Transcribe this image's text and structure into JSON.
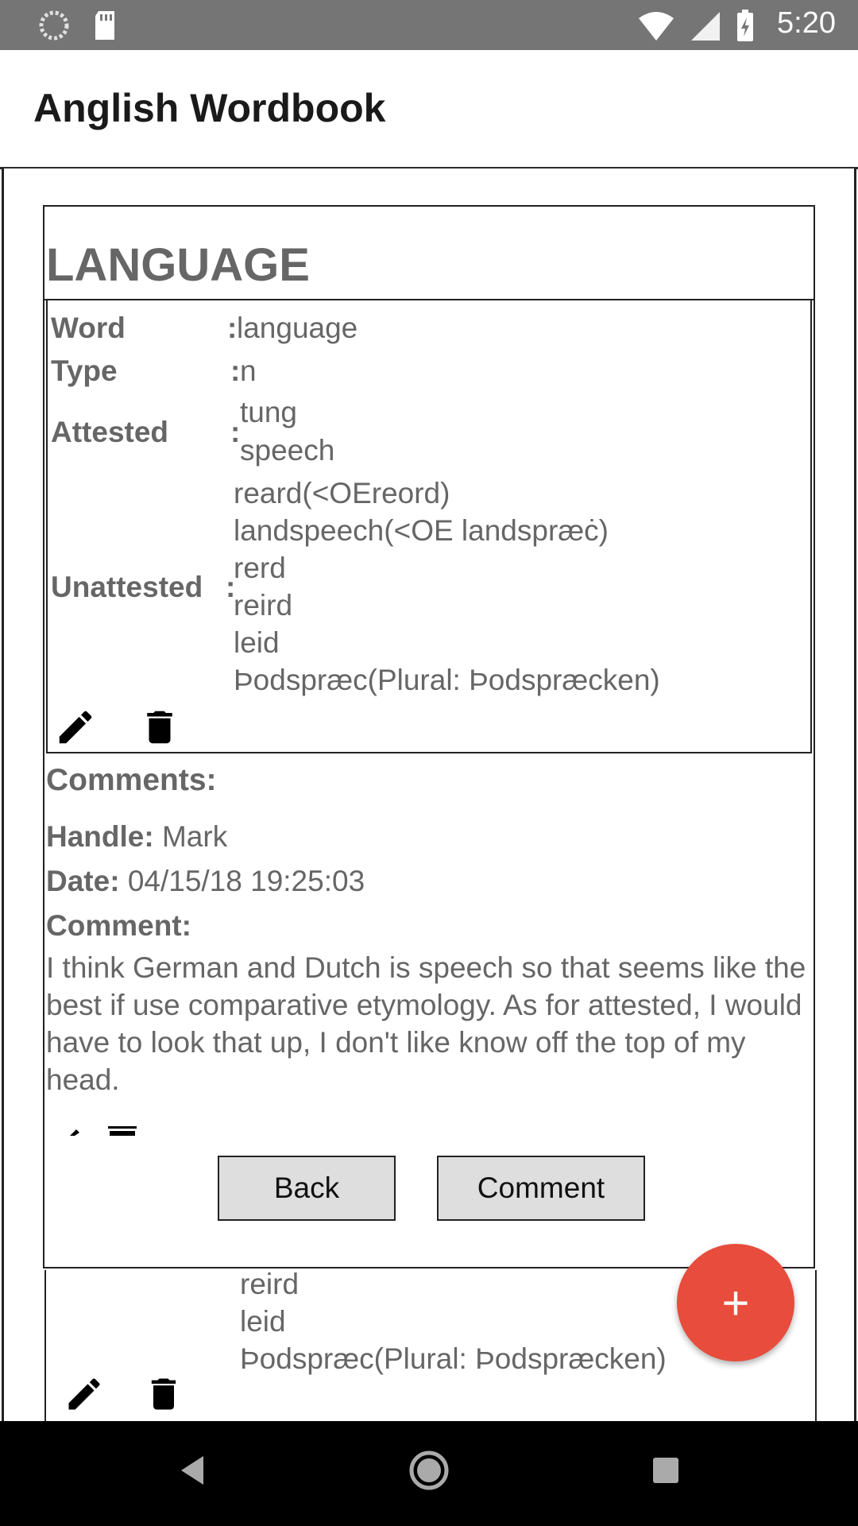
{
  "status_bar": {
    "time": "5:20"
  },
  "app_bar": {
    "title": "Anglish Wordbook"
  },
  "dialog": {
    "title": "LANGUAGE",
    "fields": {
      "word": {
        "label": "Word",
        "value": "language"
      },
      "type": {
        "label": "Type",
        "value": "n"
      },
      "attested": {
        "label": "Attested",
        "values": [
          "tung",
          "speech"
        ]
      },
      "unattested": {
        "label": "Unattested",
        "values": [
          "reard(<OEreord)",
          "landspeech(<OE landspræċ)",
          "rerd",
          "reird",
          "leid",
          "Þodspræc(Plural: Þodspræcken)"
        ]
      }
    },
    "comments": {
      "header": "Comments:",
      "handle_label": "Handle:",
      "handle_value": "Mark",
      "date_label": "Date:",
      "date_value": "04/15/18 19:25:03",
      "comment_label": "Comment:",
      "comment_text": "I think German and Dutch is speech so that seems like the best if use comparative etymology. As for attested, I would have to look that up, I don't like know off the top of my head."
    },
    "buttons": {
      "back": "Back",
      "comment": "Comment"
    }
  },
  "background_card": {
    "lines": [
      "reird",
      "leid",
      "Þodspræc(Plural: Þodspræcken)"
    ]
  },
  "fab": {
    "label": "+"
  }
}
